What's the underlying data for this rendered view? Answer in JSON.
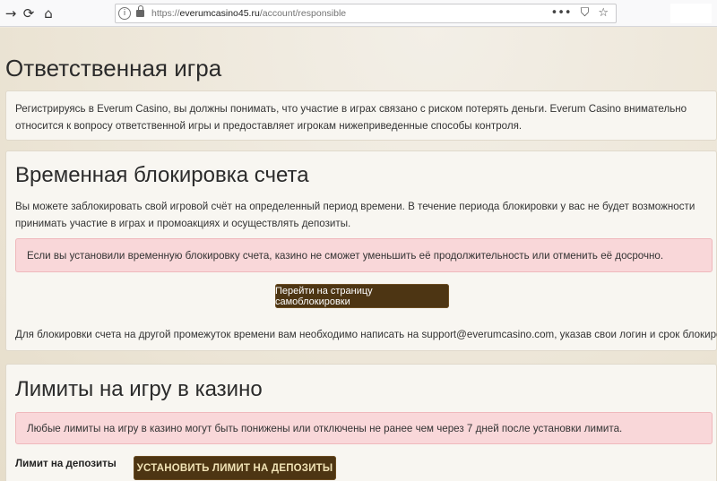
{
  "browser": {
    "url_proto": "https://",
    "url_domain": "everumcasino45.ru",
    "url_path": "/account/responsible",
    "actions": {
      "more": "•••",
      "pocket": "⛉",
      "bookmark": "☆"
    }
  },
  "page": {
    "title": "Ответственная игра",
    "intro": "Регистрируясь в Everum Casino, вы должны понимать, что участие в играх связано с риском потерять деньги. Everum Casino внимательно относится к вопросу ответственной игры и предоставляет игрокам нижеприведенные способы контроля."
  },
  "block_section": {
    "heading": "Временная блокировка счета",
    "description": "Вы можете заблокировать свой игровой счёт на определенный период времени. В течение периода блокировки у вас не будет возможности принимать участие в играх и промоакциях и осуществлять депозиты.",
    "alert": "Если вы установили временную блокировку счета, казино не сможет уменьшить её продолжительность или отменить её досрочно.",
    "button_label": "Перейти на страницу самоблокировки",
    "note": "Для блокировки счета на другой промежуток времени вам необходимо написать на support@everumcasino.com, указав свои логин и срок блокировки."
  },
  "limits_section": {
    "heading": "Лимиты на игру в казино",
    "alert": "Любые лимиты на игру в казино могут быть понижены или отключены не ранее чем через 7 дней после установки лимита.",
    "deposit_label": "Лимит на депозиты",
    "deposit_button": "УСТАНОВИТЬ ЛИМИТ НА ДЕПОЗИТЫ"
  }
}
